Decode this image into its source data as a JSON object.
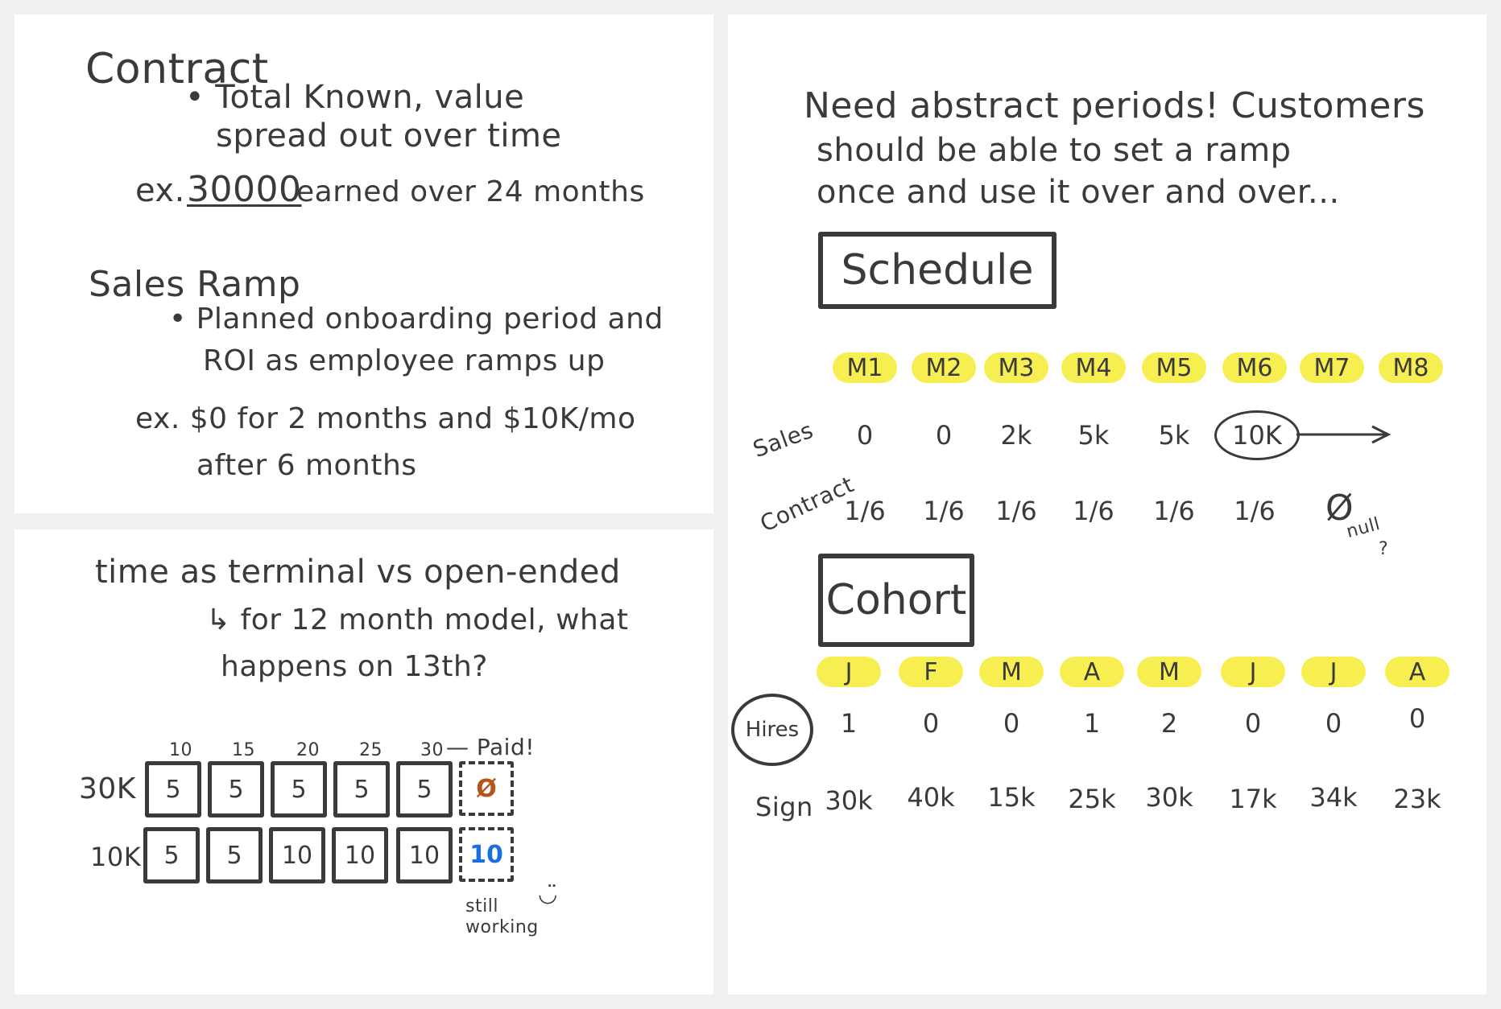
{
  "contract": {
    "heading": "Contract",
    "bullet": "• Total Known, value",
    "bullet_cont": "spread out over time",
    "ex_label": "ex.",
    "ex_amount": "30000",
    "ex_rest": "earned over 24 months"
  },
  "sales_ramp": {
    "heading": "Sales Ramp",
    "bullet": "• Planned onboarding period and",
    "bullet_cont": "ROI as employee ramps up",
    "ex_line1": "ex. $0 for 2 months and $10K/mo",
    "ex_line2": "after 6 months"
  },
  "time": {
    "line1": "time as terminal vs open-ended",
    "line2": "↳ for 12 month model, what",
    "line3": "happens on 13th?",
    "top_numbers": [
      "10",
      "15",
      "20",
      "25",
      "30"
    ],
    "paid_label": "— Paid!",
    "row_30k": {
      "label": "30K",
      "values": [
        "5",
        "5",
        "5",
        "5",
        "5"
      ],
      "last": "Ø"
    },
    "row_10k": {
      "label": "10K",
      "values": [
        "5",
        "5",
        "10",
        "10",
        "10"
      ],
      "last": "10"
    },
    "still_working": "still working",
    "smile": "◡̈"
  },
  "periods": {
    "line1": "Need abstract periods! Customers",
    "line2": "should be able to set a ramp",
    "line3": "once and use it over and over..."
  },
  "schedule": {
    "title": "Schedule",
    "months": [
      "M1",
      "M2",
      "M3",
      "M4",
      "M5",
      "M6",
      "M7",
      "M8"
    ],
    "sales_label": "Sales",
    "sales": [
      "0",
      "0",
      "2k",
      "5k",
      "5k",
      "10K"
    ],
    "contract_label": "Contract",
    "contract": [
      "1/6",
      "1/6",
      "1/6",
      "1/6",
      "1/6",
      "1/6"
    ],
    "null_symbol": "Ø",
    "null_note": "null",
    "null_q": "?"
  },
  "cohort": {
    "title": "Cohort",
    "months": [
      "J",
      "F",
      "M",
      "A",
      "M",
      "J",
      "J",
      "A"
    ],
    "hires_label": "Hires",
    "hires": [
      "1",
      "0",
      "0",
      "1",
      "2",
      "0",
      "0",
      "0"
    ],
    "sign_label": "Sign",
    "sign": [
      "30k",
      "40k",
      "15k",
      "25k",
      "30k",
      "17k",
      "34k",
      "23k"
    ]
  },
  "colors": {
    "ink": "#3a3a3a",
    "highlight": "#f7ef52",
    "paid": "#b5541c",
    "working": "#1a6fe0"
  }
}
